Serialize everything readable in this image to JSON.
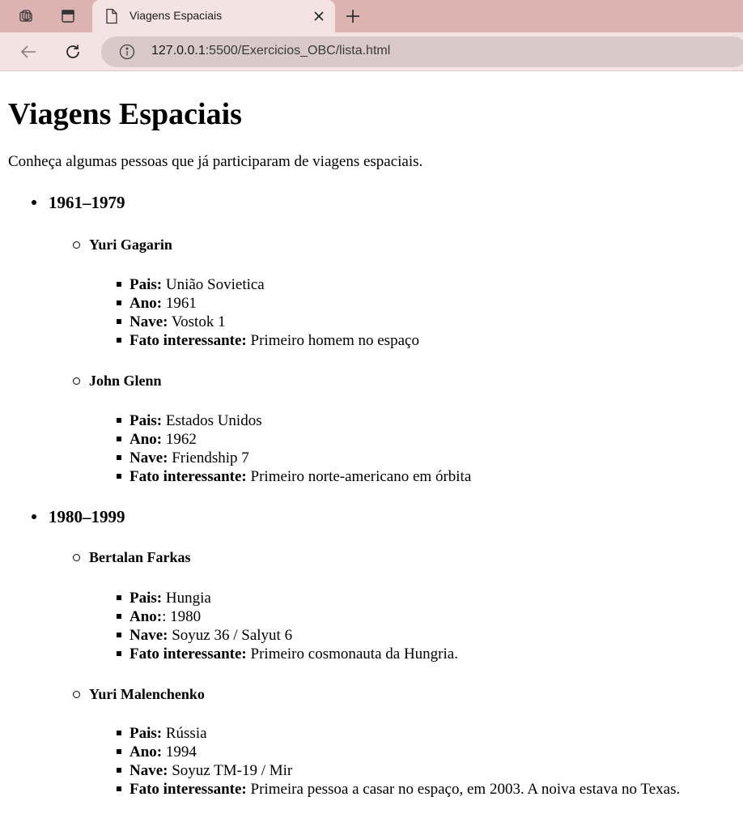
{
  "browser": {
    "tab_title": "Viagens Espaciais",
    "url_host": "127.0.0.1",
    "url_path": ":5500/Exercicios_OBC/lista.html",
    "icons": [
      "workspaces-icon",
      "tab-actions-icon",
      "page-favicon-icon",
      "close-icon",
      "new-tab-icon",
      "back-icon",
      "refresh-icon",
      "info-icon"
    ]
  },
  "page": {
    "title": "Viagens Espaciais",
    "intro": "Conheça algumas pessoas que já participaram de viagens espaciais.",
    "periods": [
      {
        "label": "1961–1979",
        "people": [
          {
            "name": "Yuri Gagarin",
            "facts": [
              {
                "label": "Pais:",
                "value": " União Sovietica"
              },
              {
                "label": "Ano:",
                "value": " 1961"
              },
              {
                "label": "Nave:",
                "value": " Vostok 1"
              },
              {
                "label": "Fato interessante:",
                "value": " Primeiro homem no espaço"
              }
            ]
          },
          {
            "name": "John Glenn",
            "facts": [
              {
                "label": "Pais:",
                "value": " Estados Unidos"
              },
              {
                "label": "Ano:",
                "value": " 1962"
              },
              {
                "label": "Nave:",
                "value": " Friendship 7"
              },
              {
                "label": "Fato interessante:",
                "value": " Primeiro norte-americano em órbita"
              }
            ]
          }
        ]
      },
      {
        "label": "1980–1999",
        "people": [
          {
            "name": "Bertalan Farkas",
            "facts": [
              {
                "label": "Pais:",
                "value": " Hungia"
              },
              {
                "label": "Ano:",
                "value": ": 1980"
              },
              {
                "label": "Nave:",
                "value": " Soyuz 36 / Salyut 6"
              },
              {
                "label": "Fato interessante:",
                "value": " Primeiro cosmonauta da Hungria."
              }
            ]
          },
          {
            "name": "Yuri Malenchenko",
            "facts": [
              {
                "label": "Pais:",
                "value": " Rússia"
              },
              {
                "label": "Ano:",
                "value": " 1994"
              },
              {
                "label": "Nave:",
                "value": " Soyuz TM-19 / Mir"
              },
              {
                "label": "Fato interessante:",
                "value": " Primeira pessoa a casar no espaço, em 2003. A noiva estava no Texas."
              }
            ]
          }
        ]
      }
    ]
  }
}
